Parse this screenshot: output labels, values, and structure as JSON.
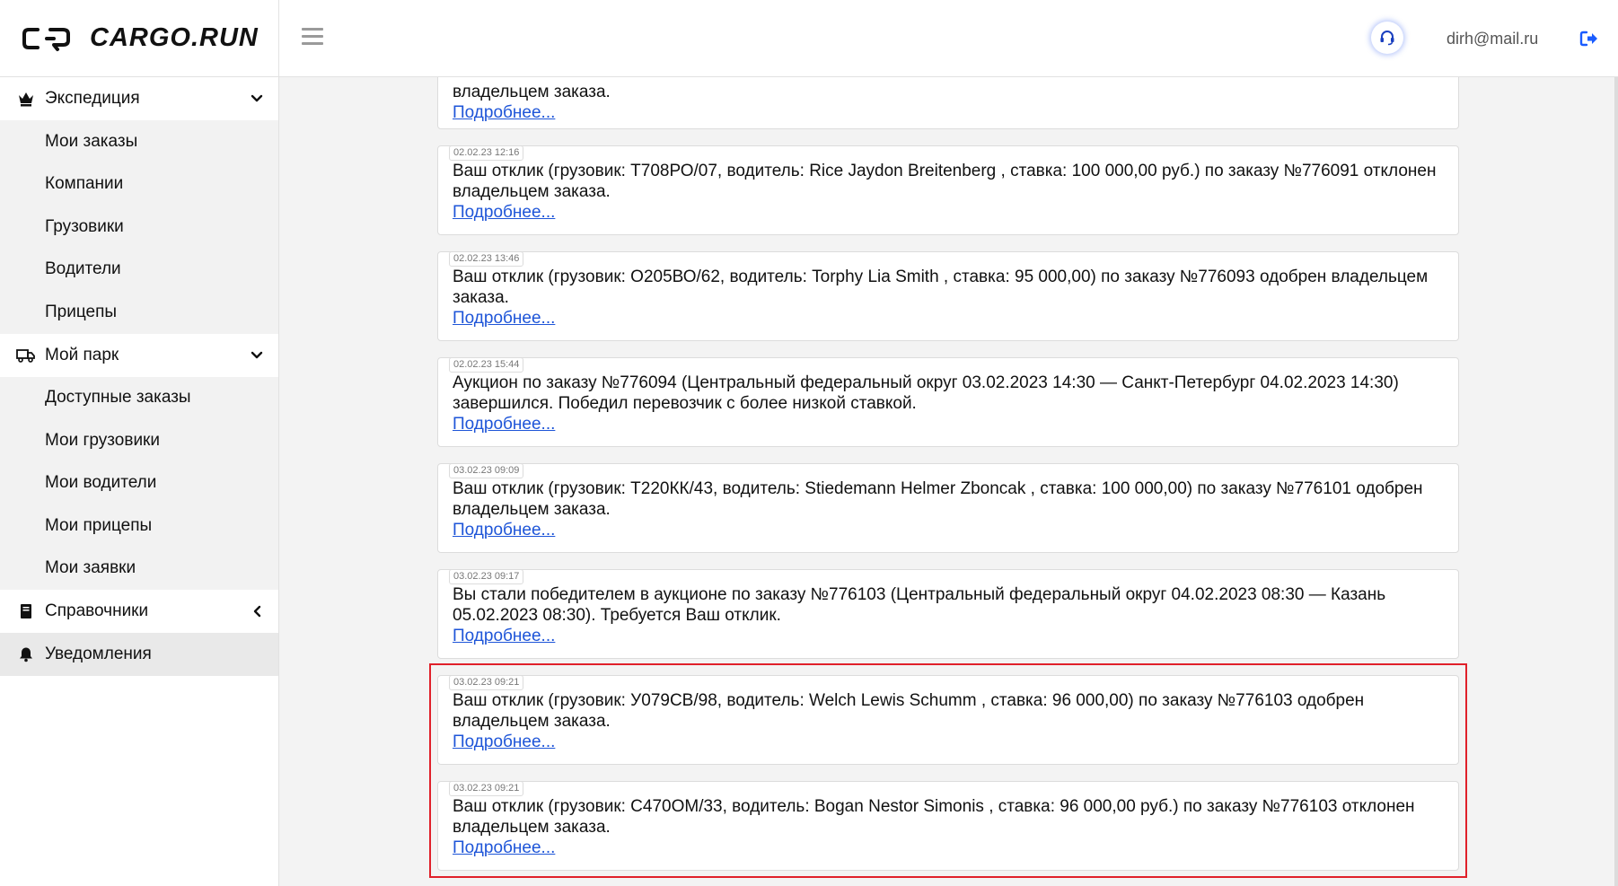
{
  "brand": {
    "name": "CARGO.RUN"
  },
  "sidebar": {
    "sections": [
      {
        "label": "Экспедиция",
        "icon": "crown-icon",
        "chevron": "chevron-down-icon",
        "items": [
          "Мои заказы",
          "Компании",
          "Грузовики",
          "Водители",
          "Прицепы"
        ]
      },
      {
        "label": "Мой парк",
        "icon": "truck-icon",
        "chevron": "chevron-down-icon",
        "items": [
          "Доступные заказы",
          "Мои грузовики",
          "Мои водители",
          "Мои прицепы",
          "Мои заявки"
        ]
      },
      {
        "label": "Справочники",
        "icon": "book-icon",
        "chevron": "chevron-left-icon"
      },
      {
        "label": "Уведомления",
        "icon": "bell-icon",
        "active": true
      }
    ]
  },
  "header": {
    "menu_icon": "hamburger-icon",
    "support_icon": "headset-icon",
    "user_email": "dirh@mail.ru",
    "logout_icon": "logout-icon"
  },
  "notifications": [
    {
      "timestamp": "",
      "message": "владельцем заказа.",
      "link": "Подробнее..."
    },
    {
      "timestamp": "02.02.23 12:16",
      "message": "Ваш отклик (грузовик: Т708РО/07, водитель:  Rice Jaydon Breitenberg , ставка: 100 000,00 руб.) по заказу №776091 отклонен владельцем заказа.",
      "link": "Подробнее..."
    },
    {
      "timestamp": "02.02.23 13:46",
      "message": "Ваш отклик (грузовик: О205ВО/62, водитель:  Torphy Lia Smith , ставка: 95 000,00) по заказу №776093 одобрен владельцем заказа.",
      "link": "Подробнее..."
    },
    {
      "timestamp": "02.02.23 15:44",
      "message": "Аукцион по заказу №776094 (Центральный федеральный округ 03.02.2023 14:30 — Санкт-Петербург 04.02.2023 14:30) завершился. Победил перевозчик с более низкой ставкой.",
      "link": "Подробнее..."
    },
    {
      "timestamp": "03.02.23 09:09",
      "message": "Ваш отклик (грузовик: Т220КК/43, водитель:  Stiedemann Helmer Zboncak , ставка: 100 000,00) по заказу №776101 одобрен владельцем заказа.",
      "link": "Подробнее..."
    },
    {
      "timestamp": "03.02.23 09:17",
      "message": "Вы стали победителем в аукционе по заказу №776103 (Центральный федеральный округ 04.02.2023 08:30 — Казань 05.02.2023 08:30). Требуется Ваш отклик.",
      "link": "Подробнее..."
    },
    {
      "timestamp": "03.02.23 09:21",
      "message": "Ваш отклик (грузовик: У079СВ/98, водитель:  Welch Lewis Schumm , ставка: 96 000,00) по заказу №776103 одобрен владельцем заказа.",
      "link": "Подробнее..."
    },
    {
      "timestamp": "03.02.23 09:21",
      "message": "Ваш отклик (грузовик: С470ОМ/33, водитель:  Bogan Nestor Simonis , ставка: 96 000,00 руб.) по заказу №776103 отклонен владельцем заказа.",
      "link": "Подробнее..."
    }
  ],
  "colors": {
    "link": "#1e55d8",
    "highlight": "#e0202a",
    "support_glow": "#466ef0",
    "logout": "#1a5cff"
  }
}
